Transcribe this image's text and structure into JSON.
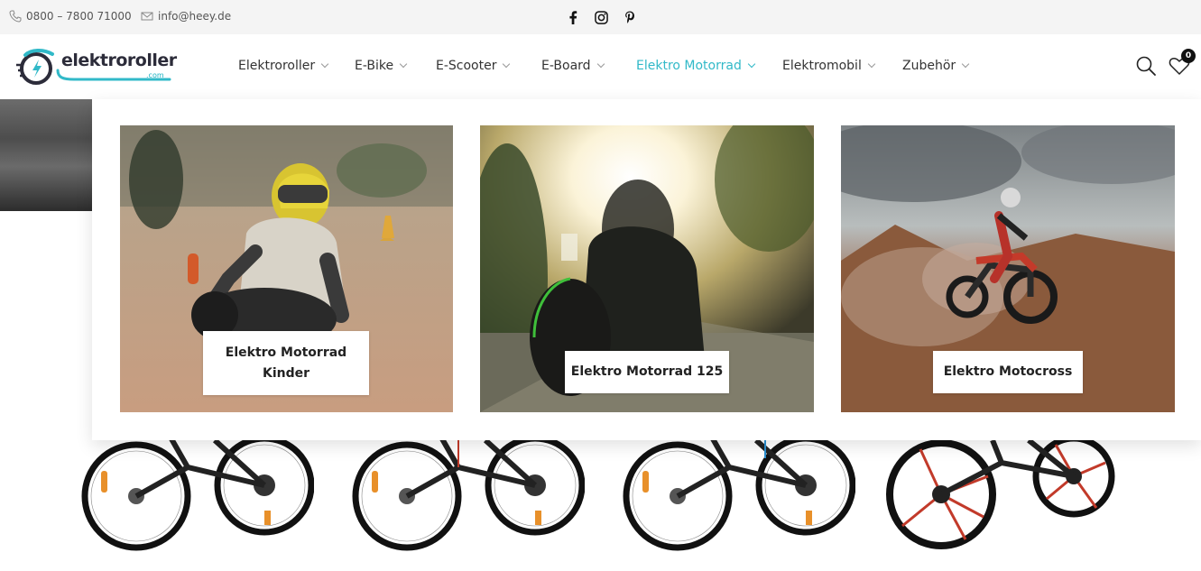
{
  "topbar": {
    "phone": "0800 – 7800 71000",
    "email": "info@heey.de",
    "social": [
      "facebook-icon",
      "instagram-icon",
      "pinterest-icon"
    ]
  },
  "header": {
    "logo_text": "elektroroller",
    "logo_suffix": ".com",
    "nav": [
      {
        "label": "Elektroroller"
      },
      {
        "label": "E-Bike"
      },
      {
        "label": "E-Scooter"
      },
      {
        "label": "E-Board"
      },
      {
        "label": "Elektro Motorrad",
        "active": true
      },
      {
        "label": "Elektromobil"
      },
      {
        "label": "Zubehör"
      }
    ],
    "cart_count": "0"
  },
  "colors": {
    "accent": "#31b9c8",
    "topbar_bg": "#f4f4f4",
    "text": "#333333"
  },
  "dropdown": {
    "cards": [
      {
        "label": "Elektro Motorrad Kinder"
      },
      {
        "label": "Elektro Motorrad 125"
      },
      {
        "label": "Elektro Motocross"
      }
    ]
  }
}
